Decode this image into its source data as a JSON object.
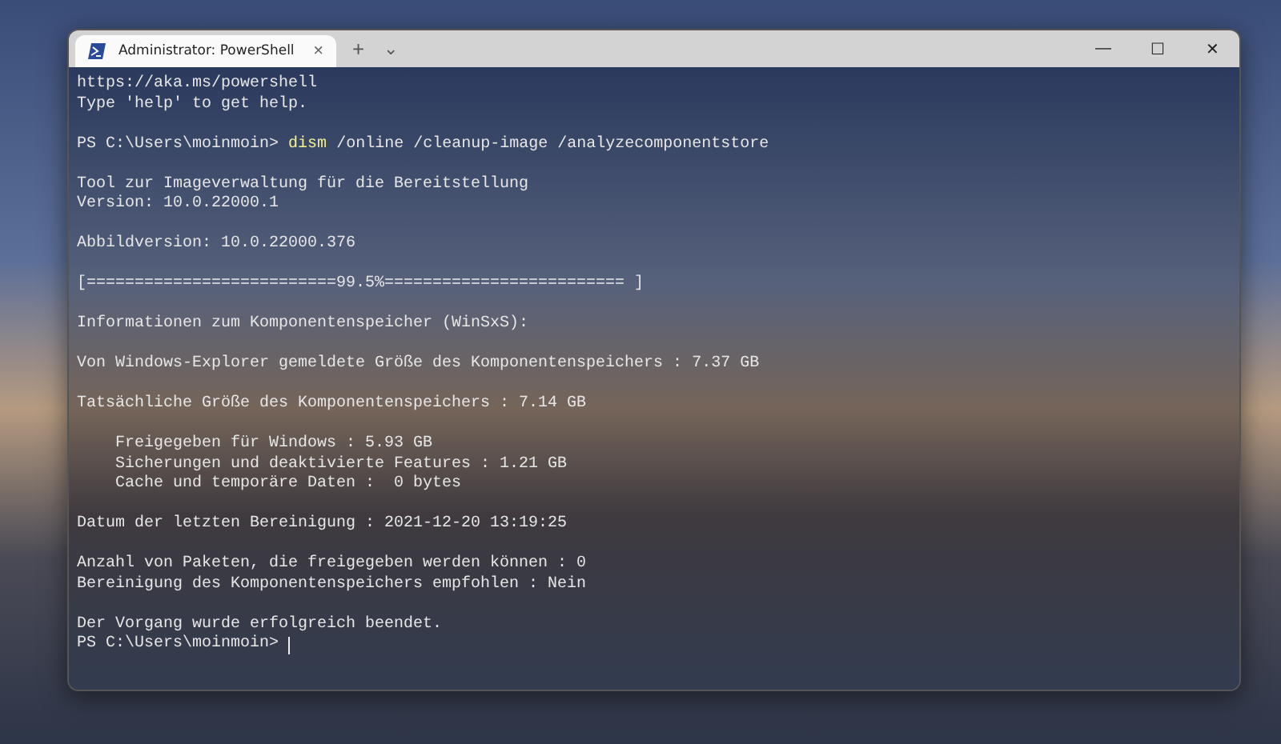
{
  "window": {
    "tab": {
      "title": "Administrator: PowerShell",
      "close": "×",
      "selected": true
    },
    "new_tab": "+",
    "dropdown": "⌄",
    "controls": [
      "—",
      "☐",
      "✕"
    ]
  },
  "terminal": {
    "lines": [
      {
        "kind": "text",
        "text": "https://aka.ms/powershell"
      },
      {
        "kind": "text",
        "text": "Type 'help' to get help."
      },
      {
        "kind": "blank"
      },
      {
        "kind": "command",
        "prompt": "PS C:\\Users\\moinmoin>",
        "command": "dism",
        "args": "/online /cleanup-image /analyzecomponentstore"
      },
      {
        "kind": "blank"
      },
      {
        "kind": "text",
        "text": "Tool zur Imageverwaltung für die Bereitstellung"
      },
      {
        "kind": "text",
        "text": "Version: 10.0.22000.1"
      },
      {
        "kind": "blank"
      },
      {
        "kind": "text",
        "text": "Abbildversion: 10.0.22000.376"
      },
      {
        "kind": "blank"
      },
      {
        "kind": "text",
        "text": "[==========================99.5%========================= ]"
      },
      {
        "kind": "blank"
      },
      {
        "kind": "text",
        "text": "Informationen zum Komponentenspeicher (WinSxS):"
      },
      {
        "kind": "blank"
      },
      {
        "kind": "text",
        "text": "Von Windows-Explorer gemeldete Größe des Komponentenspeichers : 7.37 GB"
      },
      {
        "kind": "blank"
      },
      {
        "kind": "text",
        "text": "Tatsächliche Größe des Komponentenspeichers : 7.14 GB"
      },
      {
        "kind": "blank"
      },
      {
        "kind": "indented",
        "text": "Freigegeben für Windows : 5.93 GB"
      },
      {
        "kind": "indented",
        "text": "Sicherungen und deaktivierte Features : 1.21 GB"
      },
      {
        "kind": "indented",
        "text": "Cache und temporäre Daten :  0 bytes"
      },
      {
        "kind": "blank"
      },
      {
        "kind": "text",
        "text": "Datum der letzten Bereinigung : 2021-12-20 13:19:25"
      },
      {
        "kind": "blank"
      },
      {
        "kind": "text",
        "text": "Anzahl von Paketen, die freigegeben werden können : 0"
      },
      {
        "kind": "text",
        "text": "Bereinigung des Komponentenspeichers empfohlen : Nein"
      },
      {
        "kind": "blank"
      },
      {
        "kind": "text",
        "text": "Der Vorgang wurde erfolgreich beendet."
      },
      {
        "kind": "prompt",
        "prompt": "PS C:\\Users\\moinmoin>"
      }
    ]
  }
}
